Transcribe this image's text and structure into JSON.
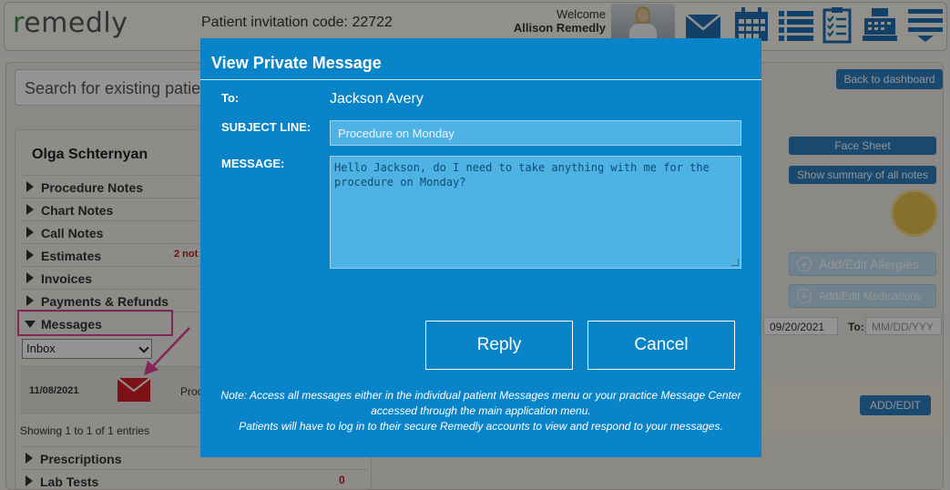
{
  "app": {
    "logo_first": "r",
    "logo_rest": "emedly",
    "invitation_code": "Patient invitation code: 22722",
    "welcome": "Welcome",
    "user_name": "Allison Remedly",
    "search_placeholder": "Search for existing patie",
    "back_label": "Back to dashboard"
  },
  "toolbar_icons": [
    "envelope-icon",
    "calendar-icon",
    "list-icon",
    "clipboard-icon",
    "cash-register-icon",
    "hamburger-menu-icon"
  ],
  "sidebar": {
    "patient_name": "Olga Schternyan",
    "items": [
      {
        "label": "Procedure Notes"
      },
      {
        "label": "Chart Notes"
      },
      {
        "label": "Call Notes"
      },
      {
        "label": "Estimates",
        "badge": "2 not"
      },
      {
        "label": "Invoices"
      },
      {
        "label": "Payments & Refunds"
      },
      {
        "label": "Messages"
      }
    ],
    "inbox_selected": "Inbox",
    "message_row": {
      "date": "11/08/2021",
      "preview": "Proc"
    },
    "entries_text": "Showing 1 to 1 of 1 entries",
    "bottom_items": [
      {
        "label": "Prescriptions"
      },
      {
        "label": "Lab Tests",
        "count": "0"
      }
    ]
  },
  "right_panel": {
    "face_sheet": "Face Sheet",
    "summary": "Show summary of all notes",
    "allergies": "Add/Edit Allergies",
    "medications": "Add/Edit Medications",
    "from_value": "09/20/2021",
    "to_label": "To:",
    "to_placeholder": "MM/DD/YYY",
    "add_edit": "ADD/EDIT"
  },
  "modal": {
    "title": "View Private Message",
    "to_label": "To:",
    "to_value": "Jackson Avery",
    "subject_label": "SUBJECT LINE:",
    "subject_value": "Procedure on Monday",
    "message_label": "MESSAGE:",
    "message_value": "Hello Jackson, do I need to take anything with me for the\nprocedure on Monday?",
    "reply_label": "Reply",
    "cancel_label": "Cancel",
    "note_line1": "Note: Access all messages either in the individual patient Messages menu or your practice Message Center",
    "note_line2": "accessed through the main application menu.",
    "note_line3": "Patients will have to log in to their secure Remedly accounts to view and respond to your messages."
  },
  "colors": {
    "modal_bg": "#0a84c9",
    "accent_blue": "#2d7fc2",
    "highlight_pink": "#e43f9a",
    "envelope_red": "#d81f26"
  }
}
